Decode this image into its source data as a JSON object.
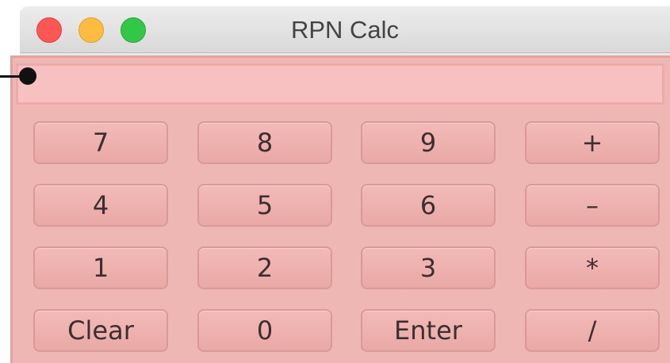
{
  "window": {
    "title": "RPN Calc"
  },
  "display": {
    "value": ""
  },
  "keys": {
    "seven": "7",
    "eight": "8",
    "nine": "9",
    "plus": "+",
    "four": "4",
    "five": "5",
    "six": "6",
    "minus": "–",
    "one": "1",
    "two": "2",
    "three": "3",
    "multiply": "*",
    "clear": "Clear",
    "zero": "0",
    "enter": "Enter",
    "divide": "/"
  },
  "colors": {
    "panel": "#eeb7b4",
    "button": "#f3bab8",
    "display": "#f6c1c0",
    "close": "#fc5753",
    "minimize": "#fdbc40",
    "maximize": "#33c748"
  }
}
